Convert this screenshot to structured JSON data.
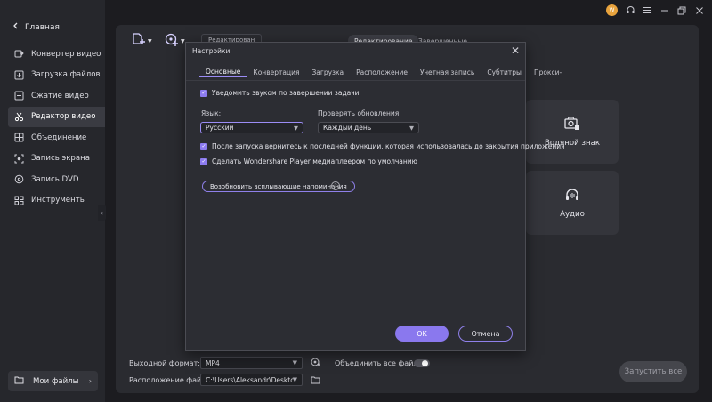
{
  "sidebar": {
    "back_label": "Главная",
    "items": [
      {
        "label": "Конвертер видео",
        "icon": "convert-icon"
      },
      {
        "label": "Загрузка файлов",
        "icon": "download-icon"
      },
      {
        "label": "Сжатие видео",
        "icon": "compress-icon"
      },
      {
        "label": "Редактор видео",
        "icon": "scissors-icon",
        "active": true
      },
      {
        "label": "Объединение",
        "icon": "merge-icon"
      },
      {
        "label": "Запись экрана",
        "icon": "record-icon"
      },
      {
        "label": "Запись DVD",
        "icon": "dvd-icon"
      },
      {
        "label": "Инструменты",
        "icon": "grid-icon"
      }
    ],
    "my_files_label": "Мои файлы"
  },
  "titlebar": {
    "avatar_text": "W"
  },
  "main": {
    "tabs": [
      {
        "label": "Редактирование",
        "active": true
      },
      {
        "label": "Завершенные",
        "active": false
      }
    ],
    "dropdown_label": "Редактирован",
    "cards": [
      {
        "label": "Водяной знак",
        "icon": "watermark-icon"
      },
      {
        "label": "Аудио",
        "icon": "headphones-icon"
      }
    ],
    "output_format_label": "Выходной формат:",
    "output_format_value": "MP4",
    "merge_label": "Объединить все файлы:",
    "merge_enabled": false,
    "location_label": "Расположение файла:",
    "location_value": "C:\\Users\\Aleksandr\\Desktop\\w",
    "start_label": "Запустить все"
  },
  "dialog": {
    "title": "Настройки",
    "tabs": [
      "Основные",
      "Конвертация",
      "Загрузка",
      "Расположение",
      "Учетная запись",
      "Субтитры",
      "Прокси-"
    ],
    "active_tab": "Основные",
    "notify_label": "Уведомить звуком по завершении задачи",
    "notify_checked": true,
    "language_label": "Язык:",
    "language_value": "Русский",
    "updates_label": "Проверять обновления:",
    "updates_value": "Каждый день",
    "resume_label": "После запуска вернитесь к последней функции, которая использовалась до закрытия приложения",
    "resume_checked": true,
    "default_player_label": "Сделать Wondershare Player медиаплеером по умолчанию",
    "default_player_checked": true,
    "restore_popups_label": "Возобновить всплывающие напоминания",
    "ok_label": "OK",
    "cancel_label": "Отмена"
  },
  "colors": {
    "accent": "#8a78ee",
    "sidebar_bg": "#26272c",
    "panel_bg": "#2a2b30",
    "dialog_bg": "#2c2d33"
  }
}
